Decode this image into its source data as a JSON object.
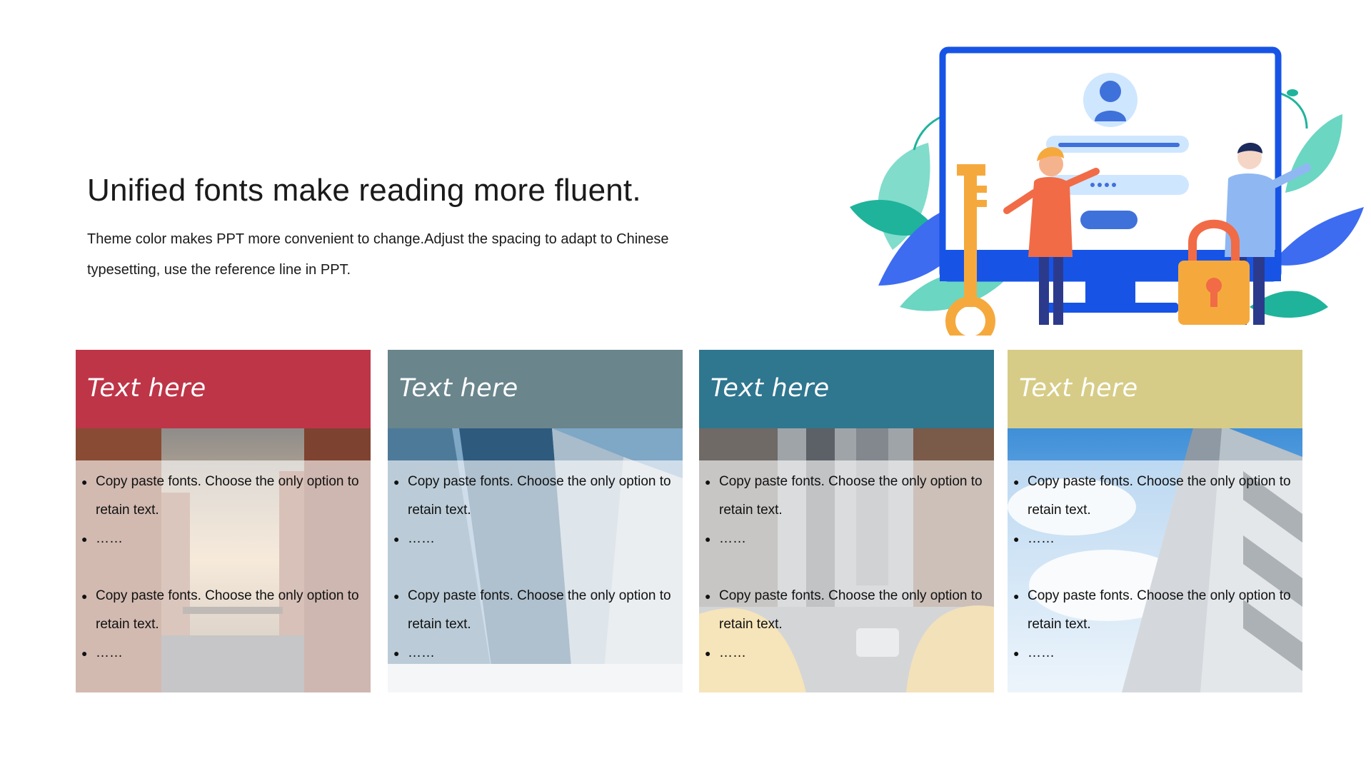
{
  "slide": {
    "title": "Unified fonts make reading more fluent.",
    "subtitle": "Theme color makes PPT more convenient to change.Adjust the spacing to adapt to Chinese typesetting, use the reference line in PPT."
  },
  "illustration": {
    "icons": [
      "monitor-icon",
      "user-avatar-icon",
      "key-icon",
      "padlock-icon",
      "woman-figure",
      "man-figure",
      "leaves-decoration"
    ]
  },
  "cards": [
    {
      "header": "Text here",
      "color": "#BE3548",
      "photo": "canal-brick-buildings",
      "bullets": [
        "Copy paste fonts. Choose the only option to retain text.",
        "……",
        "Copy paste fonts. Choose the only option to retain text.",
        "……"
      ]
    },
    {
      "header": "Text here",
      "color": "#6A858C",
      "photo": "glass-skyscrapers",
      "bullets": [
        "Copy paste fonts. Choose the only option to retain text.",
        "……",
        "Copy paste fonts. Choose the only option to retain text.",
        "……"
      ]
    },
    {
      "header": "Text here",
      "color": "#2F768F",
      "photo": "city-street-taxis",
      "bullets": [
        "Copy paste fonts. Choose the only option to retain text.",
        "……",
        "Copy paste fonts. Choose the only option to retain text.",
        "……"
      ]
    },
    {
      "header": "Text here",
      "color": "#D6CC87",
      "photo": "modern-building-sky",
      "bullets": [
        "Copy paste fonts. Choose the only option to retain text.",
        "……",
        "Copy paste fonts. Choose the only option to retain text.",
        "……"
      ]
    }
  ]
}
